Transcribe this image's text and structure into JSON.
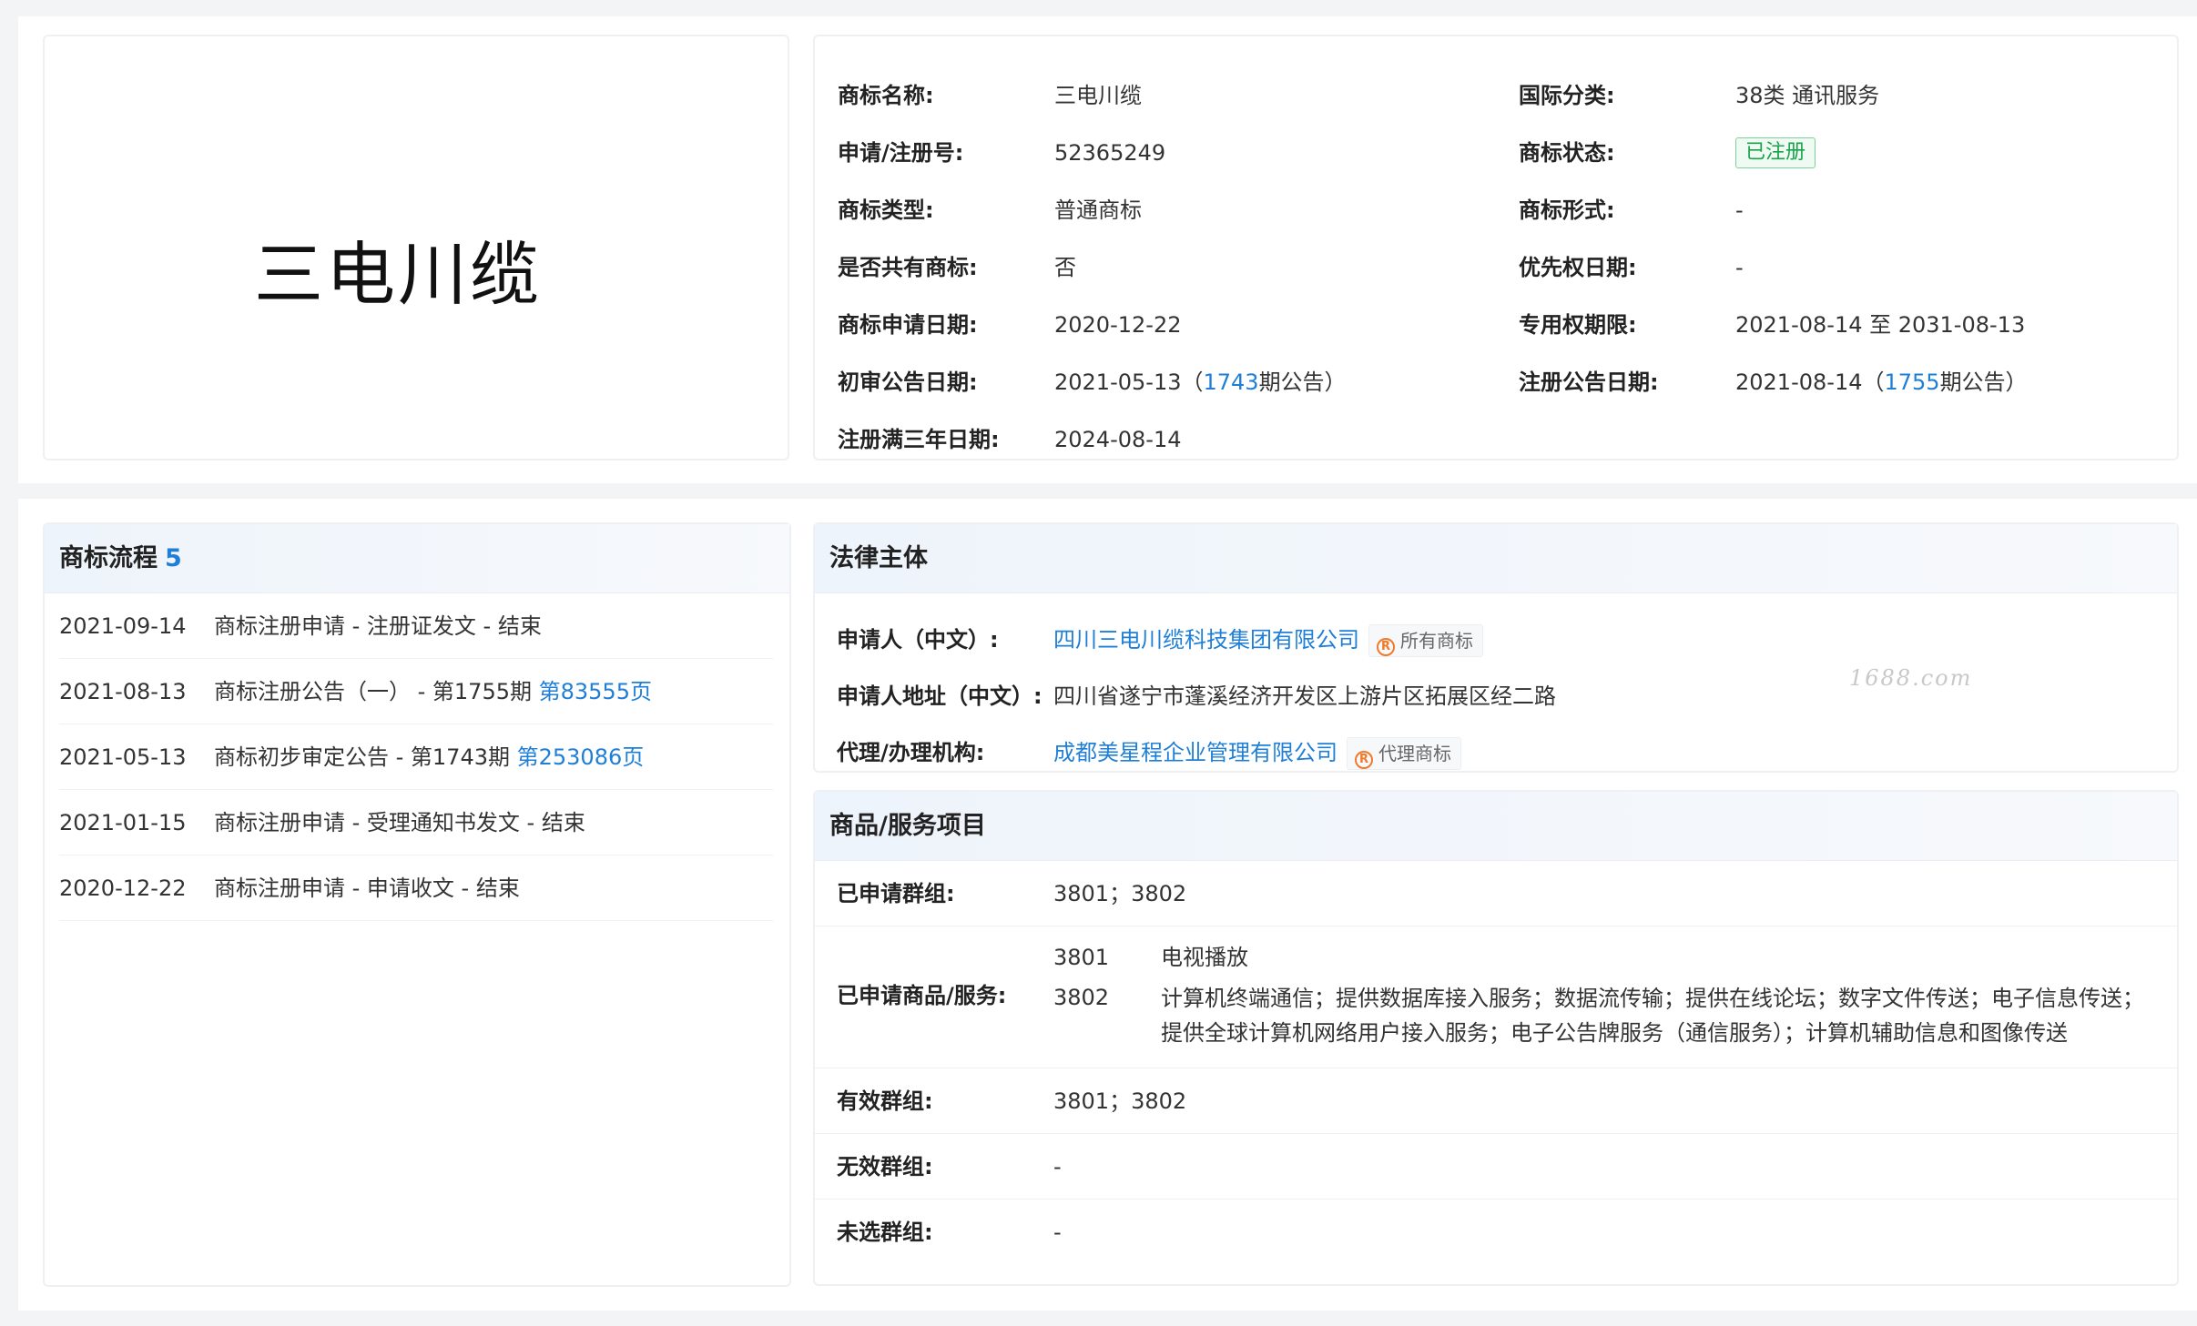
{
  "trademark_image_text": "三电川缆",
  "info": {
    "left": [
      {
        "label": "商标名称:",
        "value": "三电川缆"
      },
      {
        "label": "申请/注册号:",
        "value": "52365249"
      },
      {
        "label": "商标类型:",
        "value": "普通商标"
      },
      {
        "label": "是否共有商标:",
        "value": "否"
      },
      {
        "label": "商标申请日期:",
        "value": "2020-12-22"
      },
      {
        "label": "初审公告日期:",
        "value_prefix": "2021-05-13（",
        "value_link": "1743",
        "value_suffix": "期公告）"
      },
      {
        "label": "注册满三年日期:",
        "value": "2024-08-14"
      }
    ],
    "right": [
      {
        "label": "国际分类:",
        "value": "38类 通讯服务"
      },
      {
        "label": "商标状态:",
        "badge": "已注册"
      },
      {
        "label": "商标形式:",
        "value": "-"
      },
      {
        "label": "优先权日期:",
        "value": "-"
      },
      {
        "label": "专用权期限:",
        "value": "2021-08-14 至 2031-08-13"
      },
      {
        "label": "注册公告日期:",
        "value_prefix": "2021-08-14（",
        "value_link": "1755",
        "value_suffix": "期公告）"
      }
    ]
  },
  "process": {
    "title": "商标流程",
    "count": "5",
    "items": [
      {
        "date": "2021-09-14",
        "desc": "商标注册申请 - 注册证发文 - 结束",
        "link": ""
      },
      {
        "date": "2021-08-13",
        "desc": "商标注册公告（一） - 第1755期 ",
        "link": "第83555页"
      },
      {
        "date": "2021-05-13",
        "desc": "商标初步审定公告 - 第1743期 ",
        "link": "第253086页"
      },
      {
        "date": "2021-01-15",
        "desc": "商标注册申请 - 受理通知书发文 - 结束",
        "link": ""
      },
      {
        "date": "2020-12-22",
        "desc": "商标注册申请 - 申请收文 - 结束",
        "link": ""
      }
    ]
  },
  "legal": {
    "title": "法律主体",
    "applicant_label": "申请人（中文）:",
    "applicant_name": "四川三电川缆科技集团有限公司",
    "applicant_tag": "所有商标",
    "address_label": "申请人地址（中文）:",
    "address": "四川省遂宁市蓬溪经济开发区上游片区拓展区经二路",
    "agent_label": "代理/办理机构:",
    "agent_name": "成都美星程企业管理有限公司",
    "agent_tag": "代理商标",
    "watermark": "1688.com"
  },
  "goods": {
    "title": "商品/服务项目",
    "applied_groups_label": "已申请群组:",
    "applied_groups": "3801；3802",
    "applied_services_label": "已申请商品/服务:",
    "services": [
      {
        "code": "3801",
        "desc": "电视播放"
      },
      {
        "code": "3802",
        "desc": "计算机终端通信；提供数据库接入服务；数据流传输；提供在线论坛；数字文件传送；电子信息传送；提供全球计算机网络用户接入服务；电子公告牌服务（通信服务）；计算机辅助信息和图像传送"
      }
    ],
    "valid_groups_label": "有效群组:",
    "valid_groups": "3801；3802",
    "invalid_groups_label": "无效群组:",
    "invalid_groups": "-",
    "unselected_groups_label": "未选群组:",
    "unselected_groups": "-"
  },
  "colors": {
    "link": "#1f7fd6",
    "status_green": "#1aa34a",
    "r_icon": "#f07a2a"
  }
}
